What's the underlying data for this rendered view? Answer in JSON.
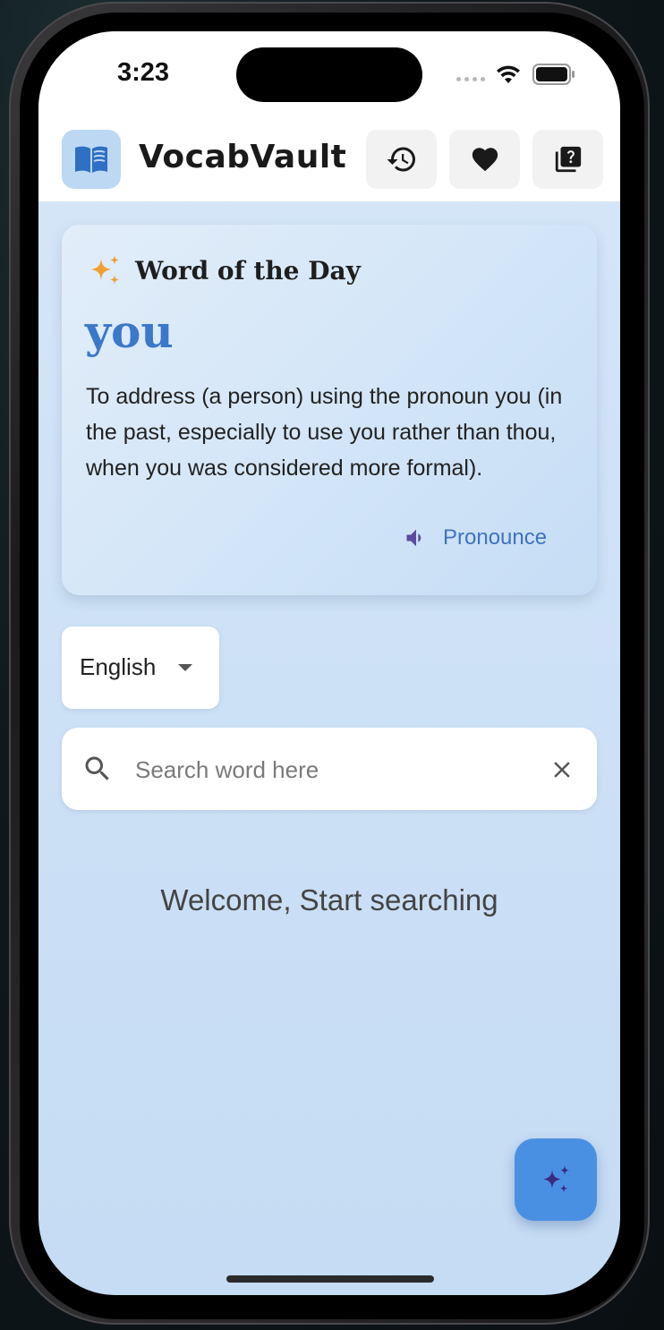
{
  "status_bar": {
    "time": "3:23"
  },
  "app_bar": {
    "title": "VocabVault",
    "logo_icon": "open-book-icon",
    "actions": [
      {
        "icon": "history-icon"
      },
      {
        "icon": "heart-icon"
      },
      {
        "icon": "quiz-icon"
      }
    ]
  },
  "word_of_the_day": {
    "heading": "Word of the Day",
    "heading_icon": "sparkles-icon",
    "word": "you",
    "definition": "To address (a person) using the pronoun you (in the past, especially to use you rather than thou, when you was considered more formal).",
    "pronounce_label": "Pronounce",
    "pronounce_icon": "speaker-icon"
  },
  "language_select": {
    "selected": "English"
  },
  "search": {
    "placeholder": "Search word here",
    "value": ""
  },
  "welcome_text": "Welcome, Start searching",
  "fab": {
    "icon": "sparkles-icon"
  },
  "colors": {
    "accent": "#4a90e2",
    "word": "#3a78c9",
    "pronounce": "#3f72c0",
    "sparkle_orange": "#f0a030",
    "speaker_purple": "#5b4aa0"
  }
}
